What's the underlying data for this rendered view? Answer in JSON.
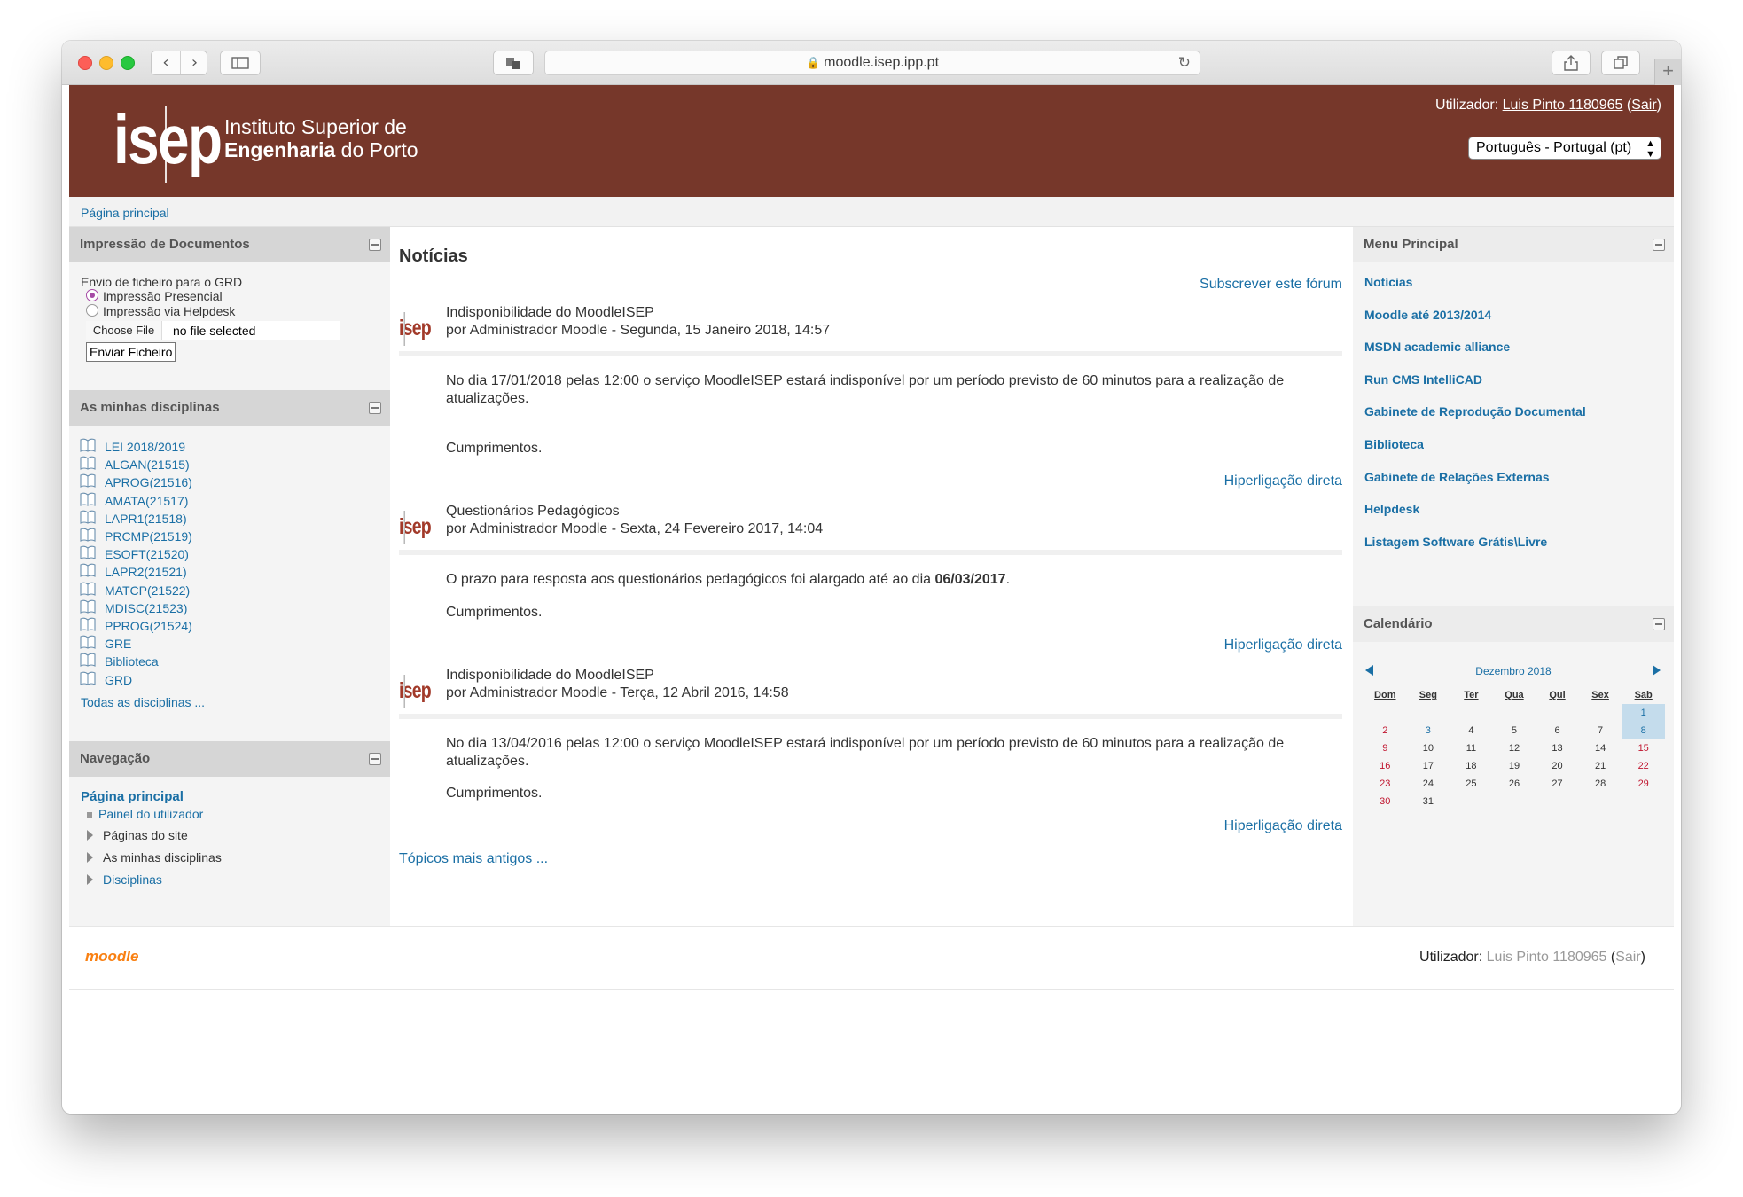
{
  "browser": {
    "url": "moodle.isep.ipp.pt"
  },
  "header": {
    "logo_mark": "isep",
    "logo_line1": "Instituto Superior de",
    "logo_line2_bold": "Engenharia",
    "logo_line2_rest": " do Porto",
    "user_prefix": "Utilizador: ",
    "user_name": "Luis Pinto 1180965",
    "logout_open": " (",
    "logout_label": "Sair",
    "logout_close": ")",
    "language": "Português - Portugal (pt)"
  },
  "breadcrumb": {
    "home": "Página principal"
  },
  "print_block": {
    "title": "Impressão de Documentos",
    "caption": "Envio de ficheiro para o GRD",
    "option1": "Impressão Presencial",
    "option2": "Impressão via Helpdesk",
    "choose_file": "Choose File",
    "no_file": "no file selected",
    "submit": "Enviar Ficheiro"
  },
  "courses_block": {
    "title": "As minhas disciplinas",
    "items": [
      "LEI 2018/2019",
      "ALGAN(21515)",
      "APROG(21516)",
      "AMATA(21517)",
      "LAPR1(21518)",
      "PRCMP(21519)",
      "ESOFT(21520)",
      "LAPR2(21521)",
      "MATCP(21522)",
      "MDISC(21523)",
      "PPROG(21524)",
      "GRE",
      "Biblioteca",
      "GRD"
    ],
    "all_link": "Todas as disciplinas ..."
  },
  "nav_block": {
    "title": "Navegação",
    "home": "Página principal",
    "dashboard": "Painel do utilizador",
    "site_pages": "Páginas do site",
    "my_courses": "As minhas disciplinas",
    "courses": "Disciplinas"
  },
  "news": {
    "title": "Notícias",
    "subscribe": "Subscrever este fórum",
    "post_logo": "isep",
    "posts": [
      {
        "title": "Indisponibilidade do MoodleISEP",
        "byline": "por Administrador Moodle - Segunda, 15 Janeiro 2018, 14:57",
        "body1": "No dia 17/01/2018 pelas 12:00 o serviço MoodleISEP estará indisponível por um período previsto de 60 minutos para a realização de atualizações.",
        "body2": "Cumprimentos.",
        "link": "Hiperligação direta"
      },
      {
        "title": "Questionários Pedagógicos",
        "byline": "por Administrador Moodle - Sexta, 24 Fevereiro 2017, 14:04",
        "body1_pre": "O prazo para resposta aos questionários pedagógicos foi alargado até ao dia ",
        "body1_bold": "06/03/2017",
        "body1_post": ".",
        "body2": "Cumprimentos.",
        "link": "Hiperligação direta"
      },
      {
        "title": "Indisponibilidade do MoodleISEP",
        "byline": "por Administrador Moodle - Terça, 12 Abril 2016, 14:58",
        "body1": "No dia 13/04/2016 pelas 12:00 o serviço MoodleISEP estará indisponível por um período previsto de 60 minutos para a realização de atualizações.",
        "body2": "Cumprimentos.",
        "link": "Hiperligação direta"
      }
    ],
    "older": "Tópicos mais antigos ..."
  },
  "menu_block": {
    "title": "Menu Principal",
    "items": [
      "Notícias",
      "Moodle até 2013/2014",
      "MSDN academic alliance",
      "Run CMS IntelliCAD",
      "Gabinete de Reprodução Documental",
      "Biblioteca",
      "Gabinete de Relações Externas",
      "Helpdesk",
      "Listagem Software Grátis\\Livre"
    ]
  },
  "calendar": {
    "title": "Calendário",
    "month": "Dezembro 2018",
    "days": [
      "Dom",
      "Seg",
      "Ter",
      "Qua",
      "Qui",
      "Sex",
      "Sab"
    ],
    "weeks": [
      [
        "",
        "",
        "",
        "",
        "",
        "",
        "1"
      ],
      [
        "2",
        "3",
        "4",
        "5",
        "6",
        "7",
        "8"
      ],
      [
        "9",
        "10",
        "11",
        "12",
        "13",
        "14",
        "15"
      ],
      [
        "16",
        "17",
        "18",
        "19",
        "20",
        "21",
        "22"
      ],
      [
        "23",
        "24",
        "25",
        "26",
        "27",
        "28",
        "29"
      ],
      [
        "30",
        "31",
        "",
        "",
        "",
        "",
        ""
      ]
    ]
  },
  "footer": {
    "logo": "moodle",
    "user_prefix": "Utilizador: ",
    "user_name": "Luis Pinto 1180965",
    "logout_open": " (",
    "logout_label": "Sair",
    "logout_close": ")"
  },
  "colors": {
    "header_brand": "#76372a",
    "link": "#1a6fa5",
    "weekend": "#c0142e",
    "today_highlight": "#c4dcec"
  }
}
